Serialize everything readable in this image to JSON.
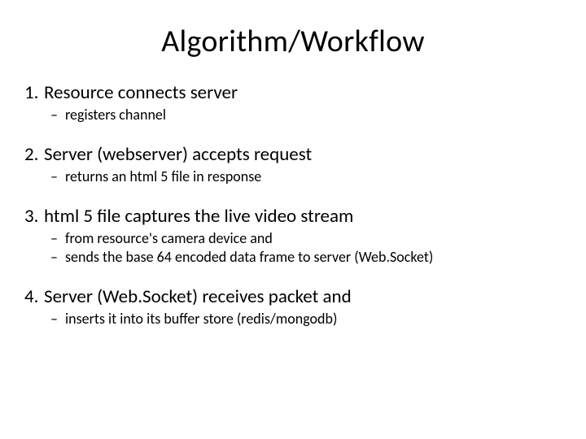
{
  "title": "Algorithm/Workflow",
  "steps": [
    {
      "num": "1.",
      "text": "Resource connects server",
      "subs": [
        "registers channel"
      ]
    },
    {
      "num": "2.",
      "text": "Server (webserver) accepts request",
      "subs": [
        "returns an html 5 file in response"
      ]
    },
    {
      "num": "3.",
      "text": "html 5 file captures the live video stream",
      "subs": [
        "from resource's camera device and",
        "sends the base 64 encoded data frame to server (Web.Socket)"
      ]
    },
    {
      "num": "4.",
      "text": "Server (Web.Socket) receives packet and",
      "subs": [
        "inserts it into its buffer store (redis/mongodb)"
      ]
    }
  ]
}
